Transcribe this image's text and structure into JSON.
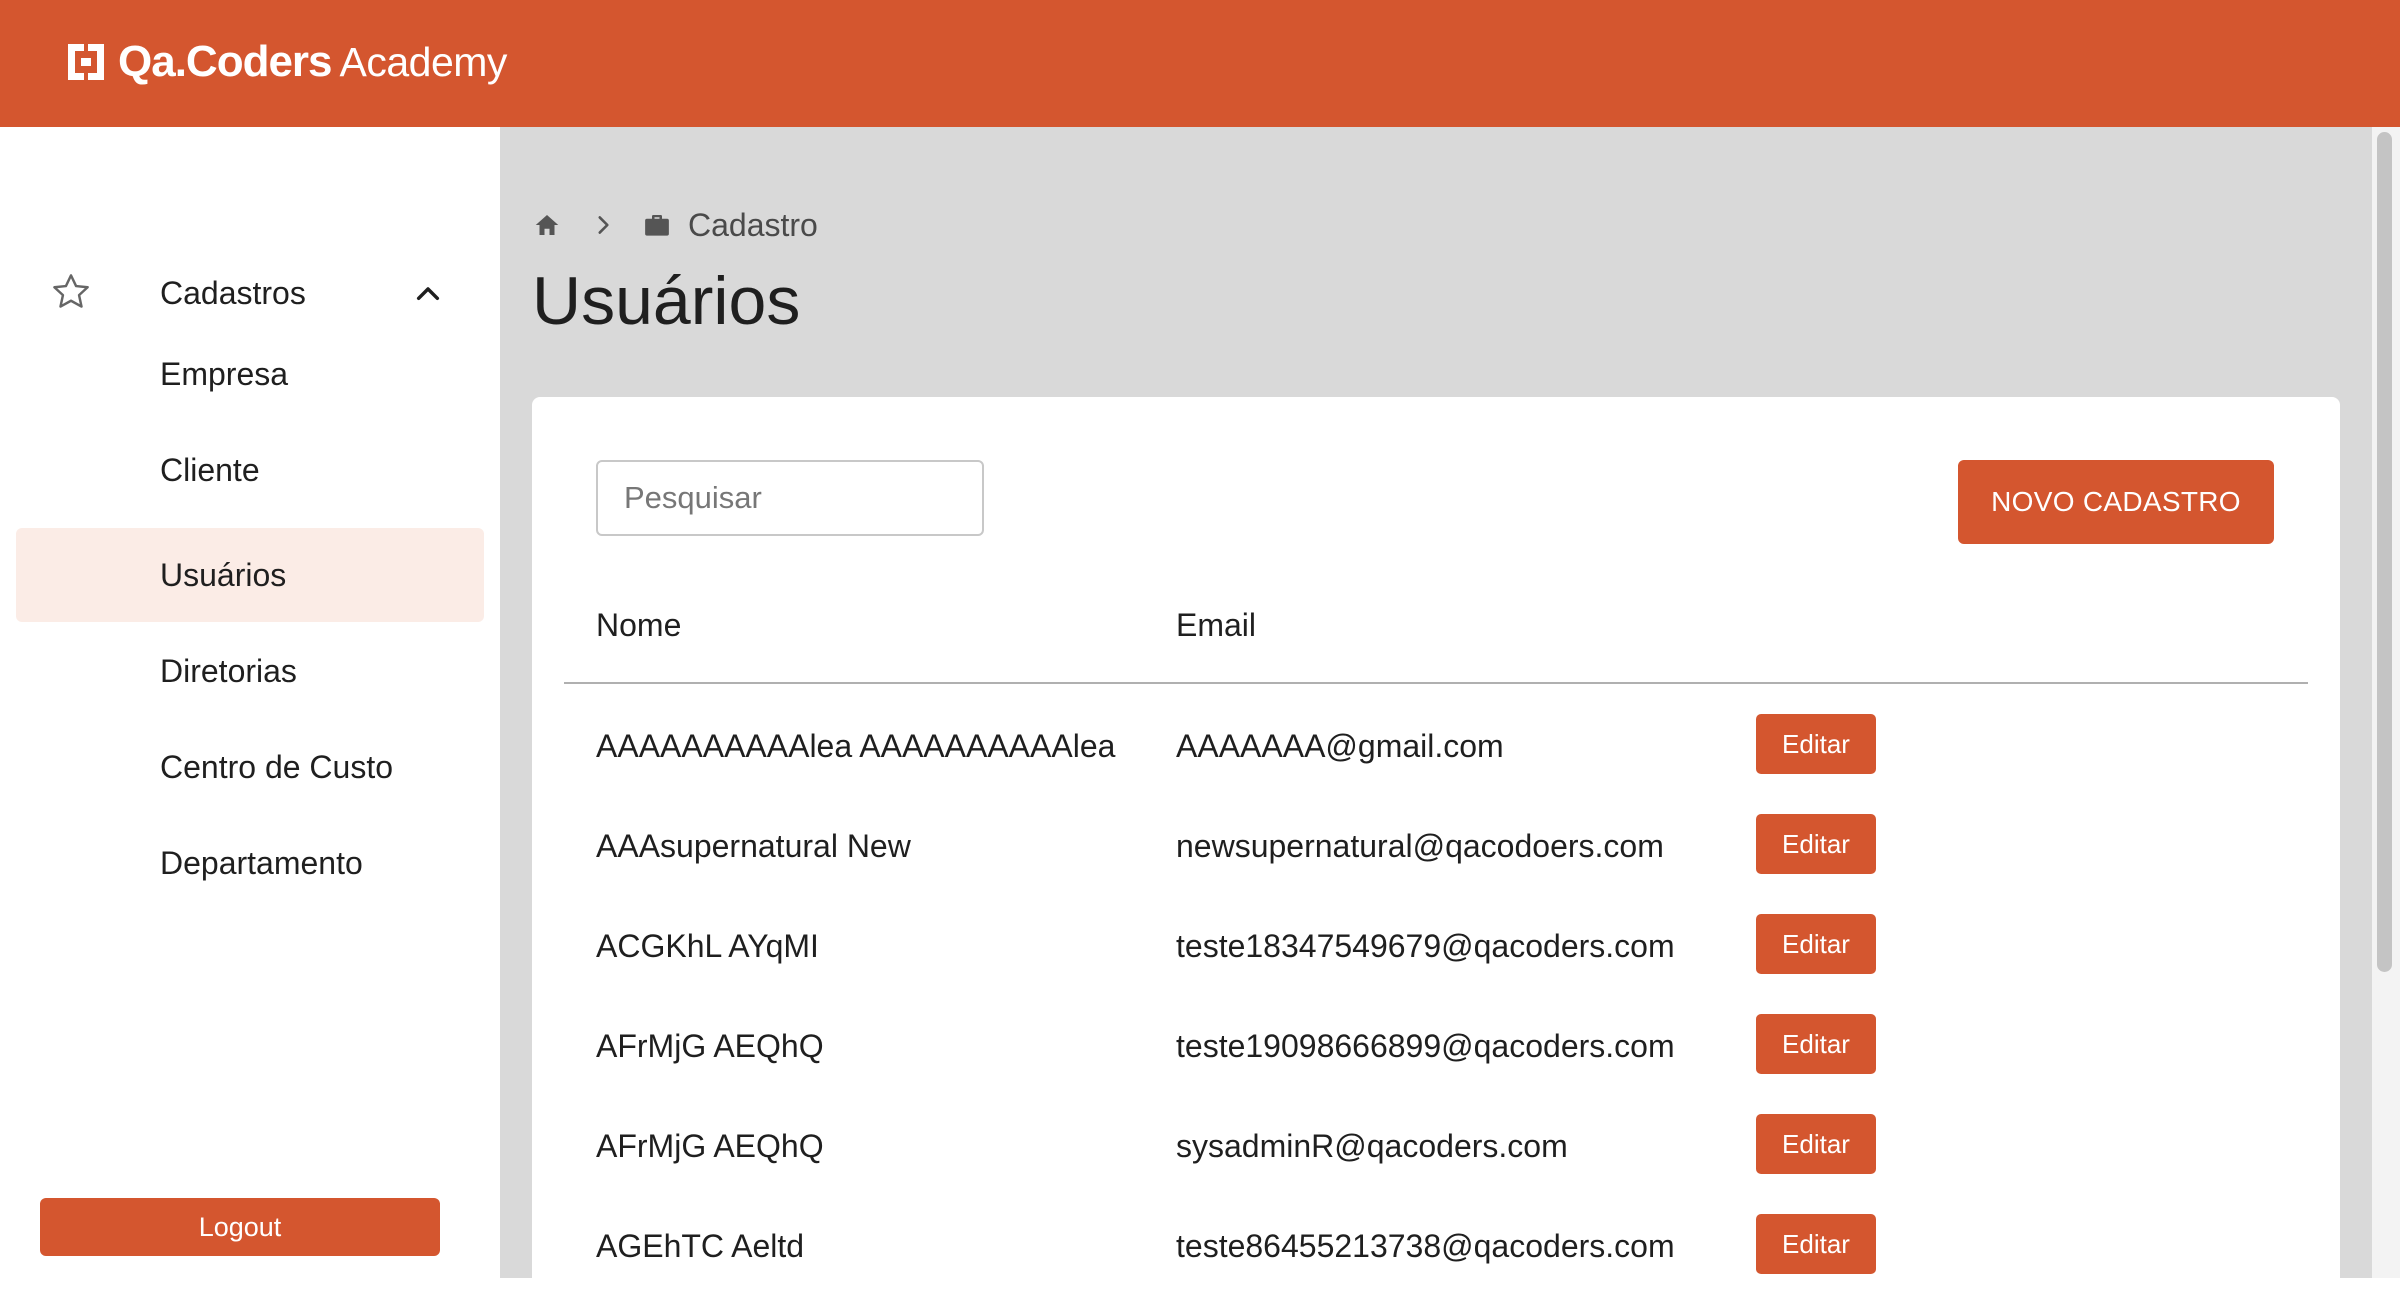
{
  "brand": {
    "name": "Qa.Coders",
    "suffix": "Academy"
  },
  "sidebar": {
    "section_label": "Cadastros",
    "items": [
      {
        "label": "Empresa"
      },
      {
        "label": "Cliente"
      },
      {
        "label": "Usuários",
        "active": true
      },
      {
        "label": "Diretorias"
      },
      {
        "label": "Centro de Custo"
      },
      {
        "label": "Departamento"
      }
    ],
    "logout_label": "Logout"
  },
  "breadcrumb": {
    "current": "Cadastro"
  },
  "page": {
    "title": "Usuários"
  },
  "search": {
    "placeholder": "Pesquisar",
    "value": ""
  },
  "toolbar": {
    "new_label": "NOVO CADASTRO"
  },
  "table": {
    "columns": [
      "Nome",
      "Email"
    ],
    "edit_label": "Editar",
    "rows": [
      {
        "name": "AAAAAAAAAAlea AAAAAAAAAAlea",
        "email": "AAAAAAA@gmail.com"
      },
      {
        "name": "AAAsupernatural New",
        "email": "newsupernatural@qacodoers.com"
      },
      {
        "name": "ACGKhL AYqMI",
        "email": "teste18347549679@qacoders.com"
      },
      {
        "name": "AFrMjG AEQhQ",
        "email": "teste19098666899@qacoders.com"
      },
      {
        "name": "AFrMjG AEQhQ",
        "email": "sysadminR@qacoders.com"
      },
      {
        "name": "AGEhTC Aeltd",
        "email": "teste86455213738@qacoders.com"
      }
    ]
  },
  "colors": {
    "accent": "#d4562f",
    "sidebar_active": "#fbece6",
    "background": "#d9d9d9"
  },
  "icons": {
    "logo": "qa-coders-logo-icon",
    "section": "star-icon",
    "collapse": "chevron-up-icon",
    "home": "home-icon",
    "separator": "chevron-right-icon",
    "briefcase": "briefcase-icon"
  }
}
